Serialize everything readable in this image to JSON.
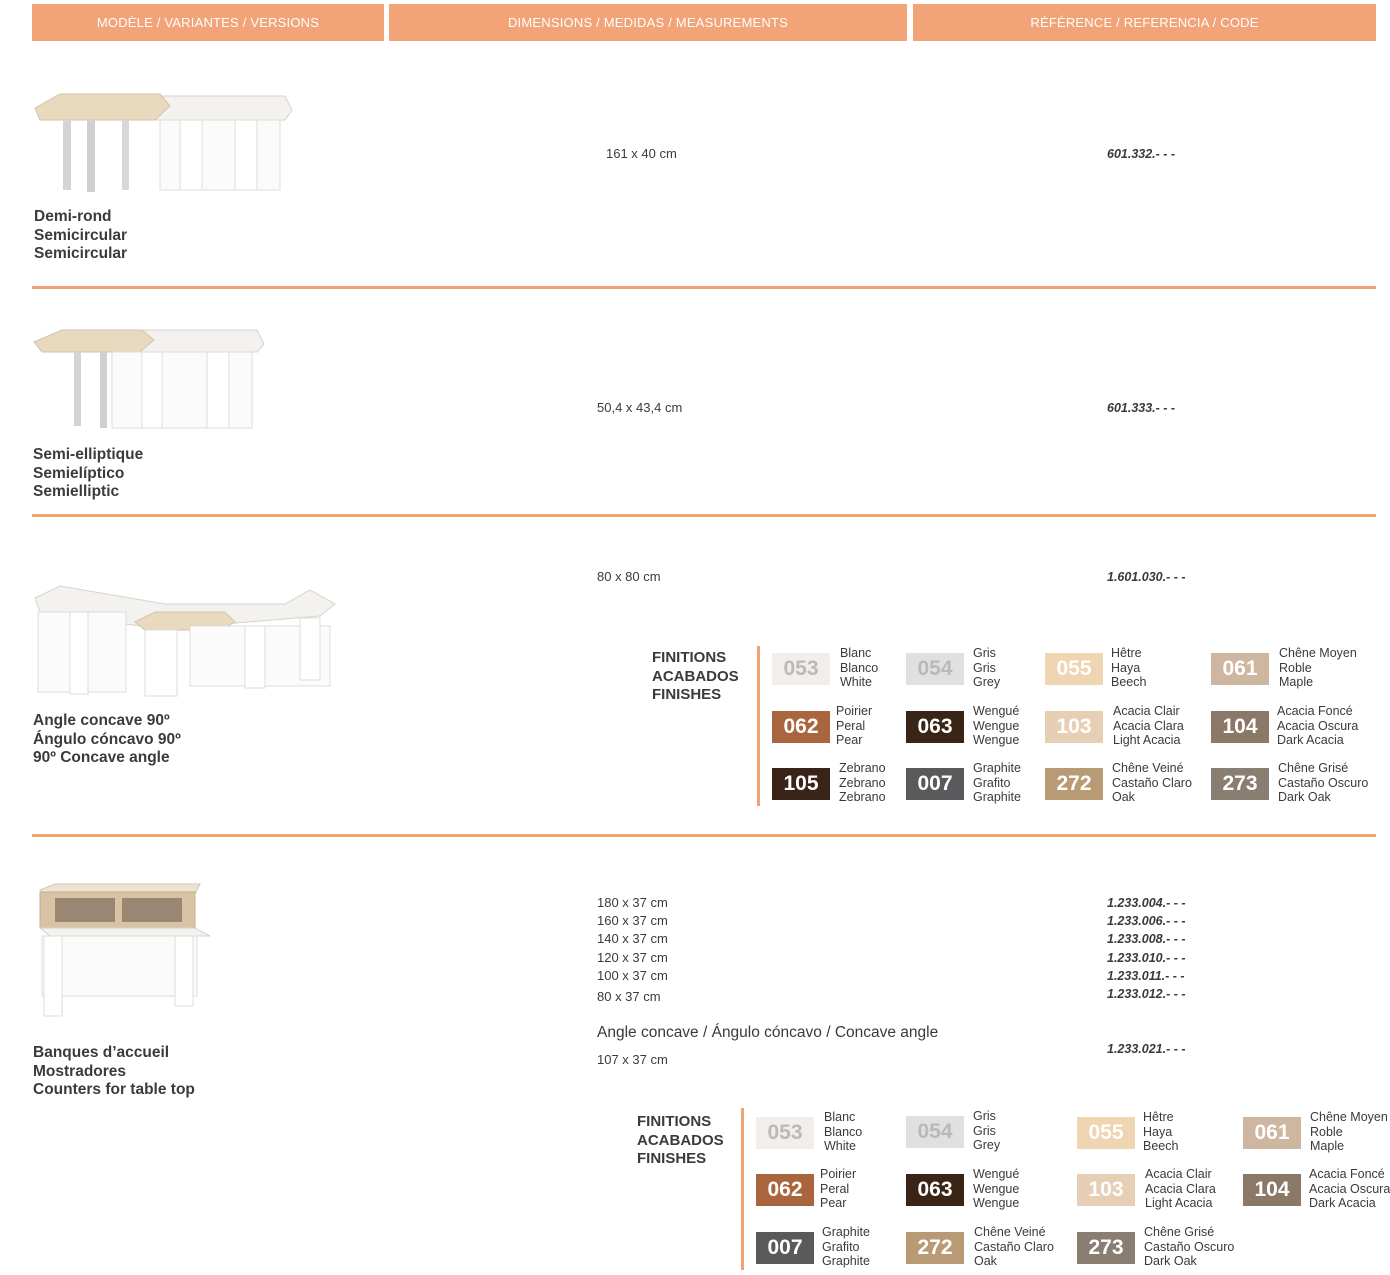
{
  "header": {
    "col1": "MODÈLE / VARIANTES / VERSIONS",
    "col2": "DIMENSIONS / MEDIDAS / MEASUREMENTS",
    "col3": "RÉFÉRENCE / REFERENCIA / CODE"
  },
  "rows": [
    {
      "name": [
        "Demi-rond",
        "Semicircular",
        "Semicircular"
      ],
      "dims": [
        "161 x 40 cm"
      ],
      "refs": [
        "601.332.- - -"
      ]
    },
    {
      "name": [
        "Semi-elliptique",
        "Semielíptico",
        "Semielliptic"
      ],
      "dims": [
        "50,4 x 43,4 cm"
      ],
      "refs": [
        "601.333.- - -"
      ]
    },
    {
      "name": [
        "Angle concave 90º",
        "Ángulo cóncavo 90º",
        "90º Concave angle"
      ],
      "dims": [
        "80 x 80 cm"
      ],
      "refs": [
        "1.601.030.- - -"
      ]
    },
    {
      "name": [
        "Banques d’accueil",
        "Mostradores",
        "Counters for table top"
      ],
      "dims": [
        "180 x 37 cm",
        "160 x 37 cm",
        "140 x 37 cm",
        "120 x 37 cm",
        "100 x 37 cm",
        "80 x 37 cm"
      ],
      "refs": [
        "1.233.004.- - -",
        "1.233.006.- - -",
        "1.233.008.- - -",
        "1.233.010.- - -",
        "1.233.011.- - -",
        "1.233.012.- - -"
      ],
      "subtitle": "Angle concave / Ángulo cóncavo / Concave angle",
      "sub_dim": "107 x 37 cm",
      "sub_ref": "1.233.021.- - -"
    }
  ],
  "finishes_title": [
    "FINITIONS",
    "ACABADOS",
    "FINISHES"
  ],
  "finishes_a": [
    {
      "code": "053",
      "color": "#f2efeb",
      "light": true,
      "labels": [
        "Blanc",
        "Blanco",
        "White"
      ]
    },
    {
      "code": "054",
      "color": "#e0e0df",
      "light": true,
      "labels": [
        "Gris",
        "Gris",
        "Grey"
      ]
    },
    {
      "code": "055",
      "color": "#efd5b1",
      "light": false,
      "labels": [
        "Hêtre",
        "Haya",
        "Beech"
      ]
    },
    {
      "code": "061",
      "color": "#cfb6a0",
      "light": false,
      "labels": [
        "Chêne Moyen",
        "Roble",
        "Maple"
      ]
    },
    {
      "code": "062",
      "color": "#a9663e",
      "light": false,
      "labels": [
        "Poirier",
        "Peral",
        "Pear"
      ]
    },
    {
      "code": "063",
      "color": "#3a2416",
      "light": false,
      "labels": [
        "Wengué",
        "Wengue",
        "Wengue"
      ]
    },
    {
      "code": "103",
      "color": "#e6cfb4",
      "light": false,
      "labels": [
        "Acacia Clair",
        "Acacia Clara",
        "Light Acacia"
      ]
    },
    {
      "code": "104",
      "color": "#8c7866",
      "light": false,
      "labels": [
        "Acacia Foncé",
        "Acacia Oscura",
        "Dark Acacia"
      ]
    },
    {
      "code": "105",
      "color": "#3a2419",
      "light": false,
      "labels": [
        "Zebrano",
        "Zebrano",
        "Zebrano"
      ]
    },
    {
      "code": "007",
      "color": "#5a5a5c",
      "light": false,
      "labels": [
        "Graphite",
        "Grafito",
        "Graphite"
      ]
    },
    {
      "code": "272",
      "color": "#b89a74",
      "light": false,
      "labels": [
        "Chêne Veiné",
        "Castaño Claro",
        "Oak"
      ]
    },
    {
      "code": "273",
      "color": "#8a7d72",
      "light": false,
      "labels": [
        "Chêne Grisé",
        "Castaño Oscuro",
        "Dark Oak"
      ]
    }
  ],
  "finishes_b": [
    {
      "code": "053",
      "color": "#f2efeb",
      "light": true,
      "labels": [
        "Blanc",
        "Blanco",
        "White"
      ]
    },
    {
      "code": "054",
      "color": "#e0e0df",
      "light": true,
      "labels": [
        "Gris",
        "Gris",
        "Grey"
      ]
    },
    {
      "code": "055",
      "color": "#efd5b1",
      "light": false,
      "labels": [
        "Hêtre",
        "Haya",
        "Beech"
      ]
    },
    {
      "code": "061",
      "color": "#cfb6a0",
      "light": false,
      "labels": [
        "Chêne Moyen",
        "Roble",
        "Maple"
      ]
    },
    {
      "code": "062",
      "color": "#a9663e",
      "light": false,
      "labels": [
        "Poirier",
        "Peral",
        "Pear"
      ]
    },
    {
      "code": "063",
      "color": "#3a2416",
      "light": false,
      "labels": [
        "Wengué",
        "Wengue",
        "Wengue"
      ]
    },
    {
      "code": "103",
      "color": "#e6cfb4",
      "light": false,
      "labels": [
        "Acacia Clair",
        "Acacia Clara",
        "Light Acacia"
      ]
    },
    {
      "code": "104",
      "color": "#8c7866",
      "light": false,
      "labels": [
        "Acacia Foncé",
        "Acacia Oscura",
        "Dark Acacia"
      ]
    },
    {
      "code": "007",
      "color": "#5a5a5c",
      "light": false,
      "labels": [
        "Graphite",
        "Grafito",
        "Graphite"
      ]
    },
    {
      "code": "272",
      "color": "#b89a74",
      "light": false,
      "labels": [
        "Chêne Veiné",
        "Castaño Claro",
        "Oak"
      ]
    },
    {
      "code": "273",
      "color": "#8a7d72",
      "light": false,
      "labels": [
        "Chêne Grisé",
        "Castaño Oscuro",
        "Dark Oak"
      ]
    }
  ]
}
